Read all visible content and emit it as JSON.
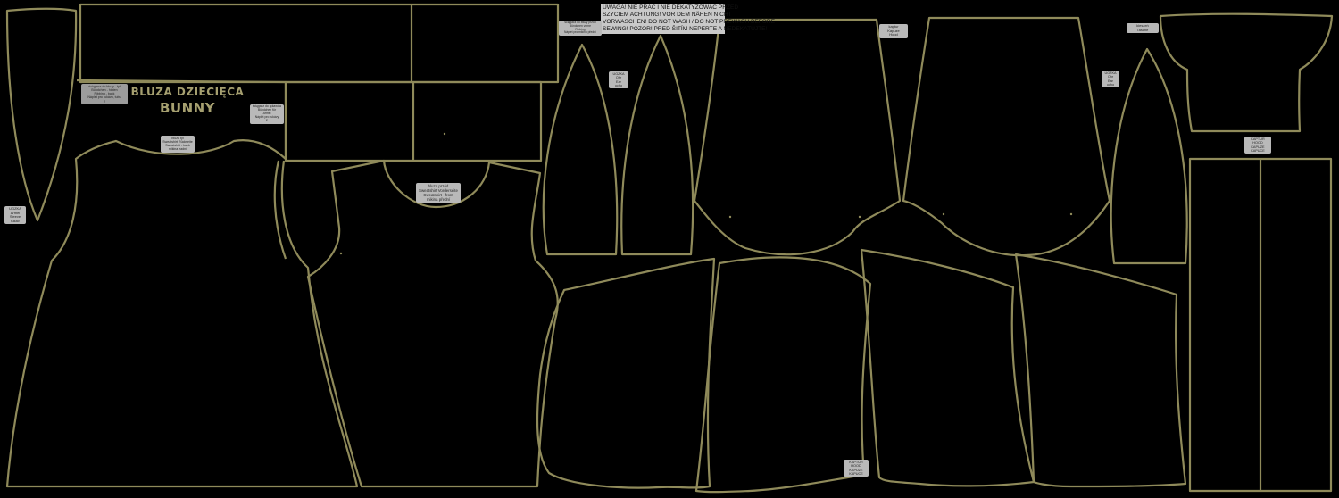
{
  "colors": {
    "background": "#000000",
    "outline": "#8f8a5a",
    "label_bg": "#b9b9b9",
    "title": "#a6a070"
  },
  "title": {
    "line1": "BLUZA DZIECIĘCA",
    "line2": "BUNNY"
  },
  "warning": [
    "UWAGA! NIE PRAĆ I NIE DEKATYZOWAĆ PRZED",
    "SZYCIEM ACHTUNG! VOR DEM NÄHEN NICHT",
    "VORWASCHEN! DO NOT WASH / DO NOT PREWASH BEFORE",
    "SEWING! POZOR! PRED ŠITÍM NEPERTE A NEDEKATUJTE!"
  ],
  "labels": {
    "sleeve_left": [
      "UGZKA",
      "Ärmel",
      "Sleeve",
      "rukáv"
    ],
    "cuff_strip": [
      "ściągacz do bluzy - tył",
      "Bündchen - hinten",
      "Ribbing - back",
      "Náplet pro rukávu, tubu",
      "2"
    ],
    "cuff_small": [
      "ściągacz do rękawów",
      "Bündchen für",
      "Ärmel",
      "Náplet pro rukávy",
      "2"
    ],
    "back_neck": [
      "bluza tył",
      "Sweatshirt Rückseite",
      "Sweatshirt - back",
      "mikina zadní"
    ],
    "front_neck": [
      "bluza przód",
      "Sweatshirt Vorderseite",
      "Sweatshirt - front",
      "mikina přední"
    ],
    "hood_strip": [
      "ściągacz do bluzy przód",
      "Bündchen vorne",
      "Ribbing",
      "Náplet pro mikinu přední"
    ],
    "ear": [
      "UGZKA",
      "Ohr",
      "Ear",
      "ucho"
    ],
    "pocket_ear": [
      "UGZKA",
      "Ohr",
      "Ear",
      "ucho"
    ],
    "pocket": [
      "kieszeń",
      "Tasche",
      "pocket",
      "kapsa"
    ],
    "hood_right": [
      "kaptur",
      "Kapuze",
      "Hood"
    ],
    "kaptur_long": [
      "KAPTUR",
      "HOOD",
      "KAPUZE",
      "KAPUCE"
    ],
    "kaptur_bottom": [
      "KAPTUR",
      "HOOD",
      "KAPUZE",
      "KAPUCE"
    ],
    "pocket_right": [
      "kieszeń",
      "Tasche"
    ],
    "ear_right": [
      "UGZKA",
      "Ohr",
      "Ear",
      "ucho"
    ]
  }
}
